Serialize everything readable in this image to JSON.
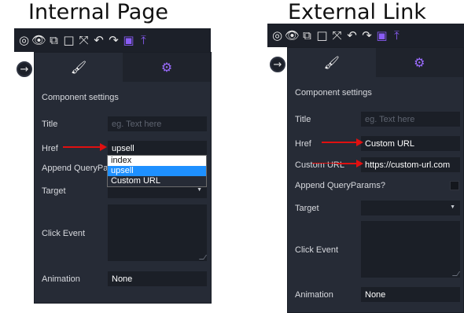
{
  "captions": {
    "left": "Internal Page",
    "right": "External Link"
  },
  "toolbar_icons": [
    "target-icon",
    "eye-icon",
    "external-link-icon",
    "square-icon",
    "expand-icon",
    "undo-icon",
    "redo-icon",
    "save-icon",
    "upload-icon"
  ],
  "left": {
    "section_title": "Component settings",
    "title_label": "Title",
    "title_placeholder": "eg. Text here",
    "href_label": "Href",
    "href_value": "upsell",
    "append_label": "Append QueryParams?",
    "append_label_visible": "Append QueryPara",
    "target_label": "Target",
    "click_event_label": "Click Event",
    "animation_label": "Animation",
    "animation_value": "None",
    "dropdown_options": [
      "index",
      "upsell",
      "Custom URL"
    ],
    "dropdown_selected": "upsell"
  },
  "right": {
    "section_title": "Component settings",
    "title_label": "Title",
    "title_placeholder": "eg. Text here",
    "href_label": "Href",
    "href_value": "Custom URL",
    "custom_url_label": "Custom URL",
    "custom_url_value": "https://custom-url.com",
    "append_label": "Append QueryParams?",
    "target_label": "Target",
    "click_event_label": "Click Event",
    "animation_label": "Animation",
    "animation_value": "None"
  },
  "colors": {
    "panel_bg": "#262b36",
    "field_bg": "#1b1f27",
    "accent_purple": "#9b6bff",
    "arrow_red": "#e01010",
    "dropdown_highlight": "#1e90ff"
  }
}
